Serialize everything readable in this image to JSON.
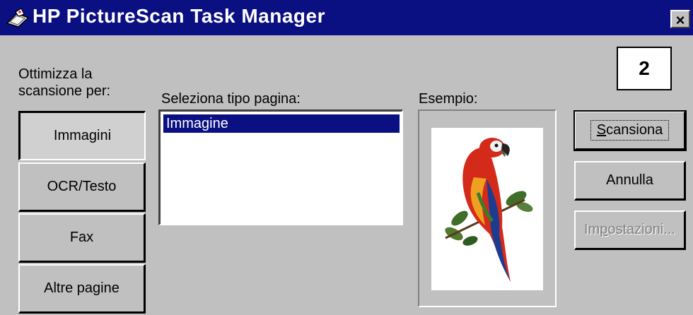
{
  "window": {
    "title": "HP PictureScan Task Manager",
    "close_glyph": "×",
    "title_icon": "scanner-icon"
  },
  "badge": {
    "number": "2"
  },
  "optimize": {
    "label": "Ottimizza la\nscansione per:",
    "buttons": [
      {
        "label": "Immagini",
        "pressed": true
      },
      {
        "label": "OCR/Testo",
        "pressed": false
      },
      {
        "label": "Fax",
        "pressed": false
      },
      {
        "label": "Altre pagine",
        "pressed": false
      }
    ]
  },
  "page_type": {
    "label": "Seleziona tipo pagina:",
    "items": [
      "Immagine"
    ],
    "selected": "Immagine"
  },
  "example": {
    "label": "Esempio:",
    "image": "parrot-illustration"
  },
  "actions": {
    "scan_first": "S",
    "scan_rest": "cansiona",
    "cancel": "Annulla",
    "settings_pre": "Im",
    "settings_u": "p",
    "settings_post": "ostazioni..."
  },
  "colors": {
    "titlebar": "#0a0f82",
    "selection": "#0a0f82",
    "face": "#c0c0c0"
  }
}
